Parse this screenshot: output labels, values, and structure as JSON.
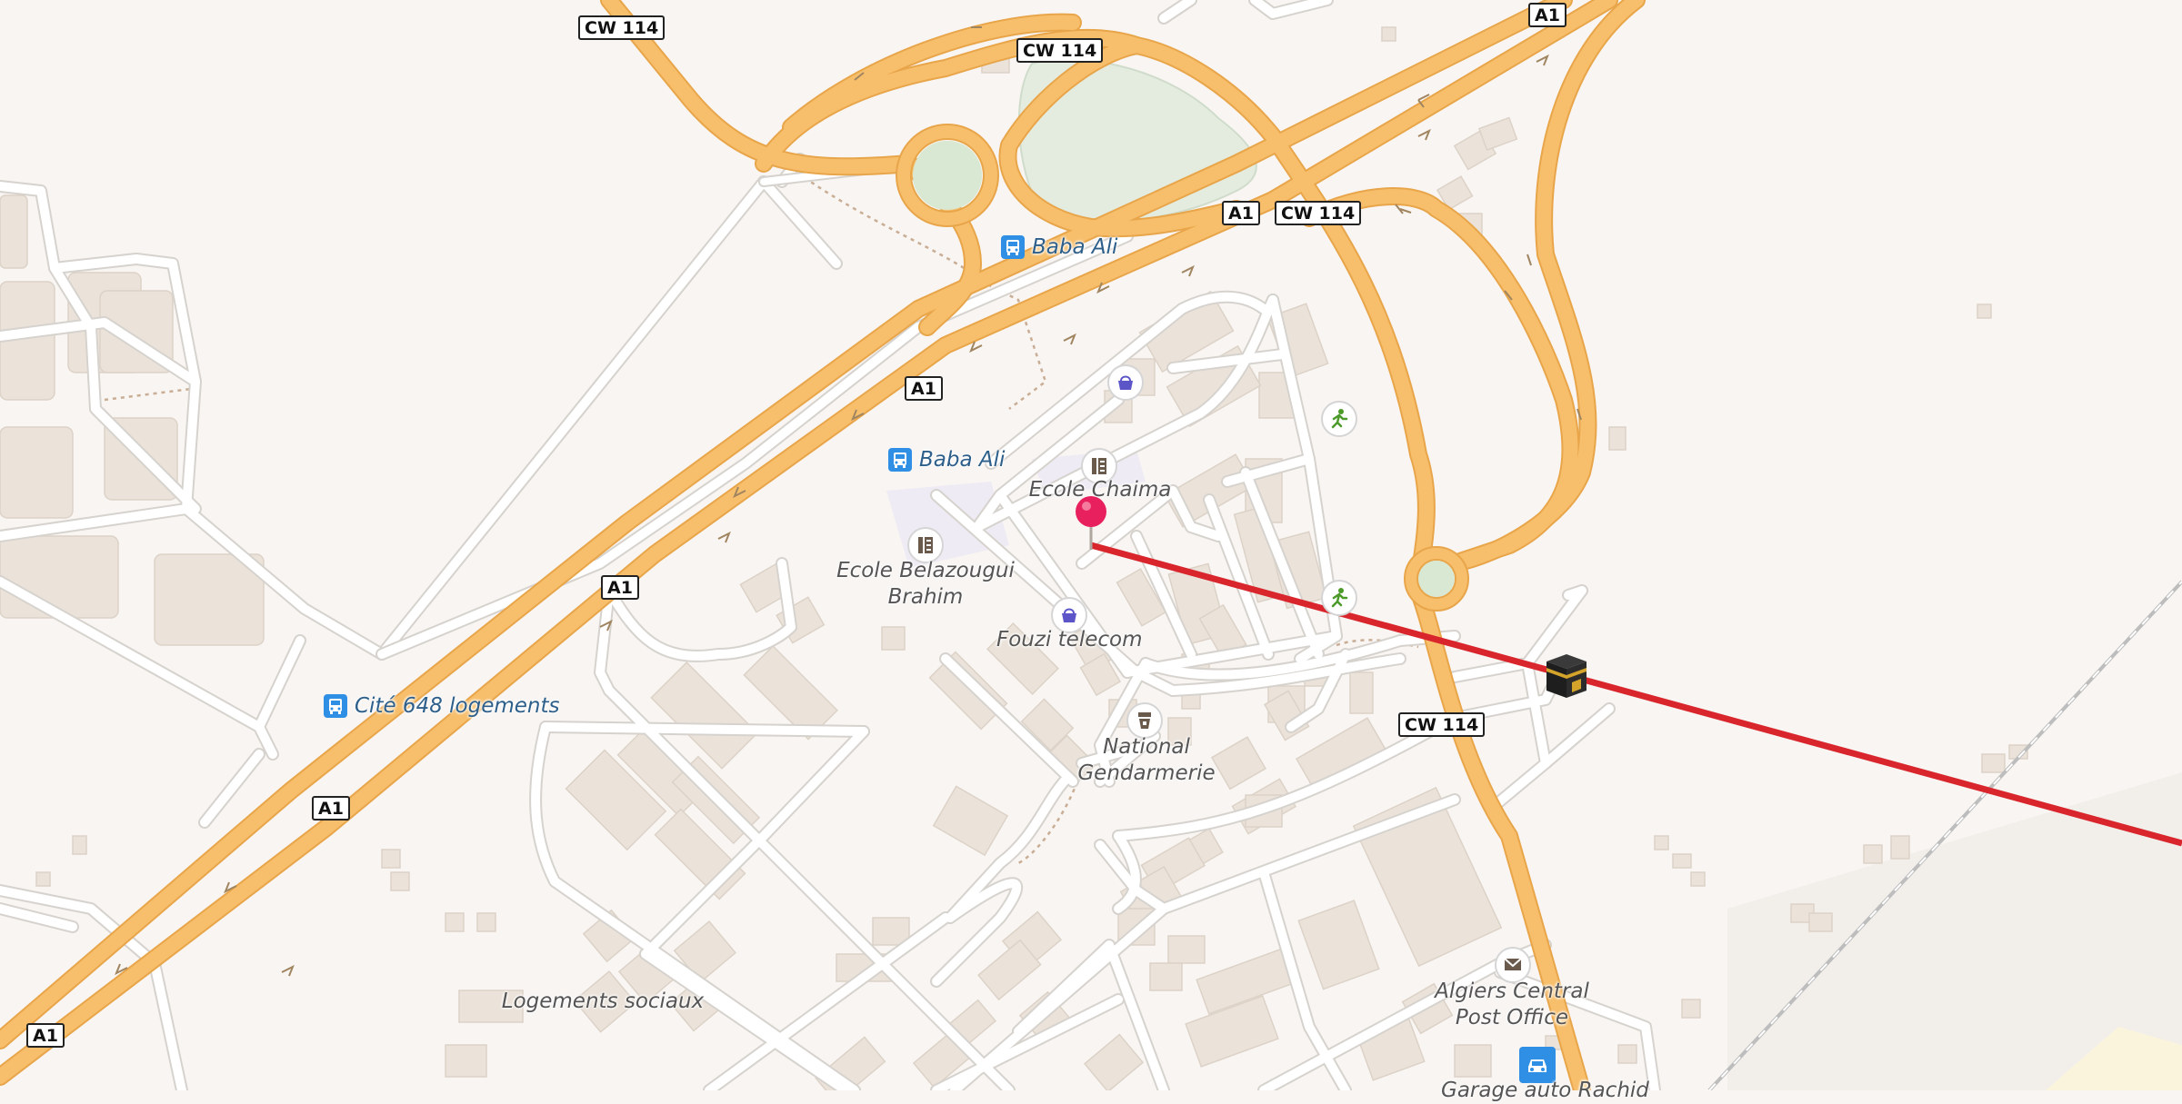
{
  "road_shields": {
    "cw114_top": "CW 114",
    "cw114_upper": "CW 114",
    "cw114_mid": "CW 114",
    "cw114_low": "CW 114",
    "a1_topright": "A1",
    "a1_mid": "A1",
    "a1_center": "A1",
    "a1_left": "A1",
    "a1_lower": "A1",
    "a1_bottomleft": "A1"
  },
  "bus_stops": {
    "baba_ali_upper": "Baba Ali",
    "baba_ali_lower": "Baba Ali",
    "cite_648": "Cité 648 logements"
  },
  "places": {
    "ecole_chaima": "Ecole Chaima",
    "ecole_belazougui": "Ecole Belazougui\nBrahim",
    "fouzi_telecom": "Fouzi telecom",
    "gendarmerie": "National\nGendarmerie",
    "logements_sociaux": "Logements sociaux",
    "post_office": "Algiers Central\nPost Office",
    "garage": "Garage auto Rachid"
  },
  "icons": {
    "pin": "location-pin-icon",
    "kaaba": "kaaba-icon",
    "shop": "shopping-basket-icon",
    "school": "school-icon",
    "sport": "sport-running-icon",
    "police": "police-icon",
    "post": "post-office-icon",
    "car": "car-repair-icon",
    "bus": "bus-stop-icon"
  },
  "colors": {
    "motorway": "#f7bf6c",
    "motorway_casing": "#e8a54a",
    "road": "#ffffff",
    "road_casing": "#d6d2cd",
    "building": "#ebe3da",
    "park": "#dfead8",
    "qibla_line": "#d8262c",
    "pin": "#e8215e",
    "bus": "#2f8fe5"
  }
}
